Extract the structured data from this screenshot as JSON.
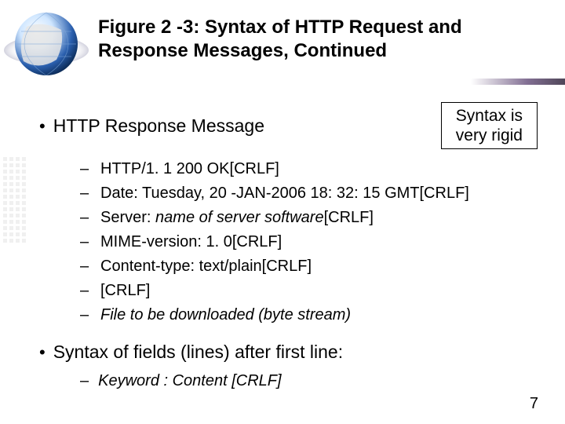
{
  "title": "Figure 2 -3: Syntax of HTTP Request and Response Messages, Continued",
  "bullet1": "HTTP Response Message",
  "callout_line1": "Syntax is",
  "callout_line2": "very rigid",
  "response_items": [
    {
      "pre": "HTTP/1. 1 200 OK[CRLF]"
    },
    {
      "pre": "Date: Tuesday, 20 -JAN-2006 18: 32: 15 GMT[CRLF]"
    },
    {
      "pre": "Server: ",
      "italic": "name of server software",
      "post": "[CRLF]"
    },
    {
      "pre": "MIME-version: 1. 0[CRLF]"
    },
    {
      "pre": "Content-type: text/plain[CRLF]"
    },
    {
      "pre": "[CRLF]"
    },
    {
      "italic": "File to be downloaded (byte stream)"
    }
  ],
  "bullet2": "Syntax of fields (lines) after first line:",
  "syntax_items": [
    {
      "italic": "Keyword : Content [CRLF]"
    }
  ],
  "page_number": "7"
}
